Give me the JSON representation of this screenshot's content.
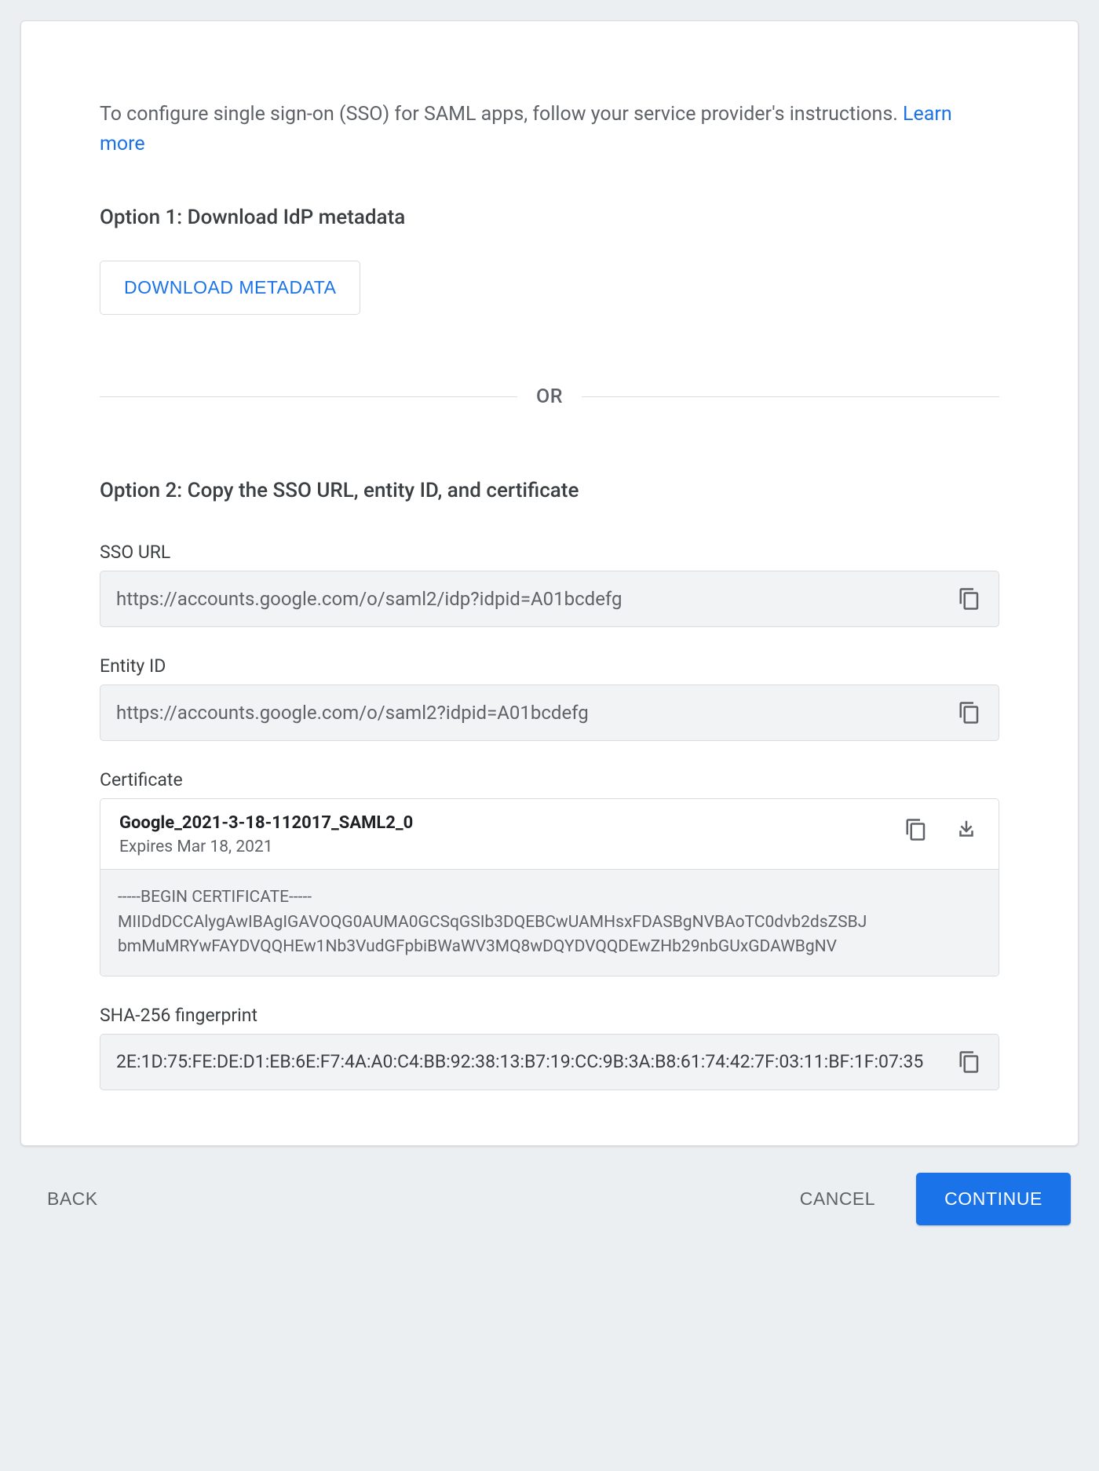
{
  "intro": {
    "text": "To configure single sign-on (SSO) for SAML apps, follow your service provider's instructions. ",
    "learn_more": "Learn more"
  },
  "option1": {
    "heading": "Option 1: Download IdP metadata",
    "button": "DOWNLOAD METADATA"
  },
  "divider": "OR",
  "option2": {
    "heading": "Option 2: Copy the SSO URL, entity ID, and certificate",
    "sso_url": {
      "label": "SSO URL",
      "value": "https://accounts.google.com/o/saml2/idp?idpid=A01bcdefg"
    },
    "entity_id": {
      "label": "Entity ID",
      "value": "https://accounts.google.com/o/saml2?idpid=A01bcdefg"
    },
    "certificate": {
      "label": "Certificate",
      "name": "Google_2021-3-18-112017_SAML2_0",
      "expires": "Expires Mar 18, 2021",
      "body": "-----BEGIN CERTIFICATE-----\nMIIDdDCCAlygAwIBAgIGAVOQG0AUMA0GCSqGSIb3DQEBCwUAMHsxFDASBgNVBAoTC0dvb2dsZSBJ\nbmMuMRYwFAYDVQQHEw1Nb3VudGFpbiBWaWV3MQ8wDQYDVQQDEwZHb29nbGUxGDAWBgNV"
    },
    "fingerprint": {
      "label": "SHA-256 fingerprint",
      "value": "2E:1D:75:FE:DE:D1:EB:6E:F7:4A:A0:C4:BB:92:38:13:B7:19:CC:9B:3A:B8:61:74:42:7F:03:11:BF:1F:07:35"
    }
  },
  "footer": {
    "back": "BACK",
    "cancel": "CANCEL",
    "continue": "CONTINUE"
  }
}
